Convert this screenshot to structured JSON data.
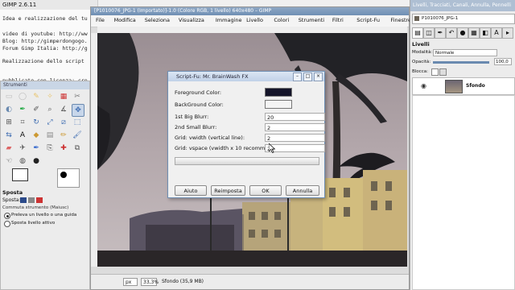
{
  "doc": {
    "title": "GIMP 2.6.11",
    "lines": [
      "Idea e realizzazione del tu",
      "",
      "video di youtube: http://ww",
      "Blog: http://gimperdongogo.",
      "Forum Gimp Italia: http://g",
      "",
      "Realizzazione dello script ",
      "",
      "pubblicato con licenza: cre"
    ]
  },
  "toolbox": {
    "title": "Strumenti",
    "options_title": "Sposta",
    "move_label": "Sposta:",
    "toggle_label": "Commuta strumento (Maiusc)",
    "option1": "Preleva un livello o una guida",
    "option2": "Sposta livello attivo"
  },
  "image_window": {
    "title": "[P1010076_JPG-1 (Importato)]-1.0 (Colore RGB, 1 livello) 640x480 – GIMP",
    "menus": [
      "File",
      "Modifica",
      "Seleziona",
      "Visualizza",
      "Immagine",
      "Livello",
      "Colori",
      "Strumenti",
      "Filtri",
      "Script-Fu",
      "Finestre",
      "Aiuto"
    ],
    "status": {
      "unit": "px",
      "zoom": "33,3%",
      "info": "Sfondo (35,9 MB)"
    }
  },
  "dialog": {
    "title": "Script-Fu: Mr. BrainWash FX",
    "fields": [
      {
        "label": "Foreground Color:",
        "type": "color",
        "color": "#15152a"
      },
      {
        "label": "BackGround Color:",
        "type": "color",
        "color": "#f4f4f4"
      },
      {
        "label": "1st Big Blurr:",
        "type": "number",
        "value": "20"
      },
      {
        "label": "2nd Small Blurr:",
        "type": "number",
        "value": "2"
      },
      {
        "label": "Grid: vwidth (vertical line):",
        "type": "number",
        "value": "2"
      },
      {
        "label": "Grid: vspace (vwidth x 10 recommended):",
        "type": "number",
        "value": "20"
      }
    ],
    "buttons": {
      "help": "Aiuto",
      "reset": "Reimposta",
      "ok": "OK",
      "cancel": "Annulla"
    }
  },
  "layers_panel": {
    "title": "Livelli, Tracciati, Canali, Annulla, Pennelli",
    "image_name": "P1010076_JPG-1",
    "section": "Livelli",
    "mode_label": "Modalità:",
    "mode_value": "Normale",
    "opacity_label": "Opacità:",
    "opacity_value": "100,0",
    "opacity_fraction": 1.0,
    "lock_label": "Blocca:",
    "layer_name": "Sfondo"
  }
}
